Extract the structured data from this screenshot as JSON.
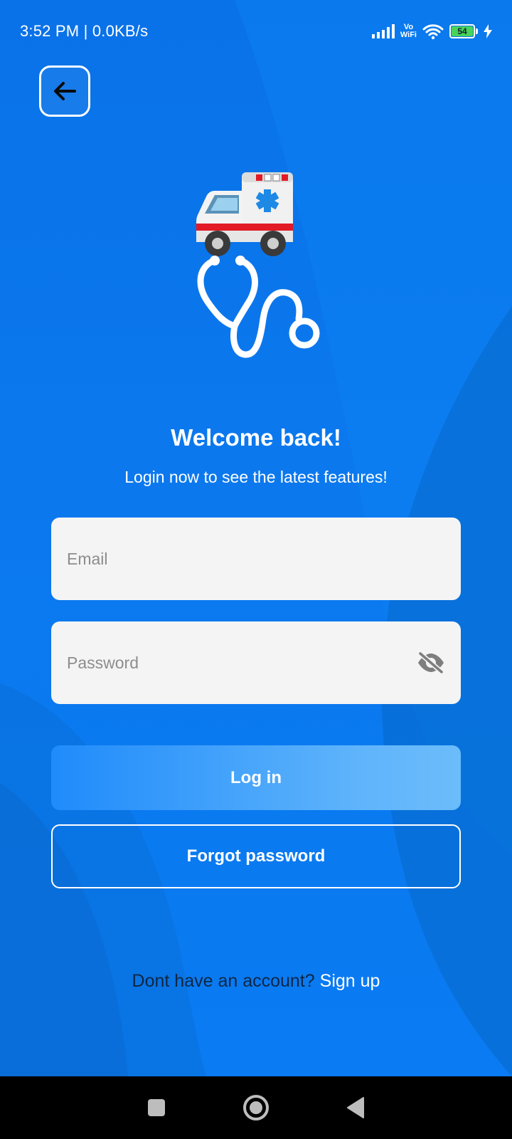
{
  "status_bar": {
    "time_speed": "3:52 PM | 0.0KB/s",
    "vowifi_top": "Vo",
    "vowifi_bottom": "WiFi",
    "battery_level": "54"
  },
  "header": {
    "back_icon": "arrow-left-icon"
  },
  "hero": {
    "icons": [
      "ambulance-icon",
      "stethoscope-icon"
    ]
  },
  "login": {
    "title": "Welcome back!",
    "subtitle": "Login now to see the latest features!",
    "email_placeholder": "Email",
    "password_placeholder": "Password",
    "password_toggle_icon": "eye-off-icon",
    "login_label": "Log in",
    "forgot_label": "Forgot password",
    "signup_prompt": "Dont have an account?",
    "signup_link": "Sign up"
  },
  "nav": {
    "icons": [
      "recents-square-icon",
      "home-circle-icon",
      "back-triangle-icon"
    ]
  },
  "colors": {
    "background": "#0a78ee",
    "input_bg": "#f4f4f5",
    "login_gradient_start": "#1f8bfb",
    "login_gradient_end": "#6bbcfa",
    "signup_prompt": "#0d2745"
  }
}
